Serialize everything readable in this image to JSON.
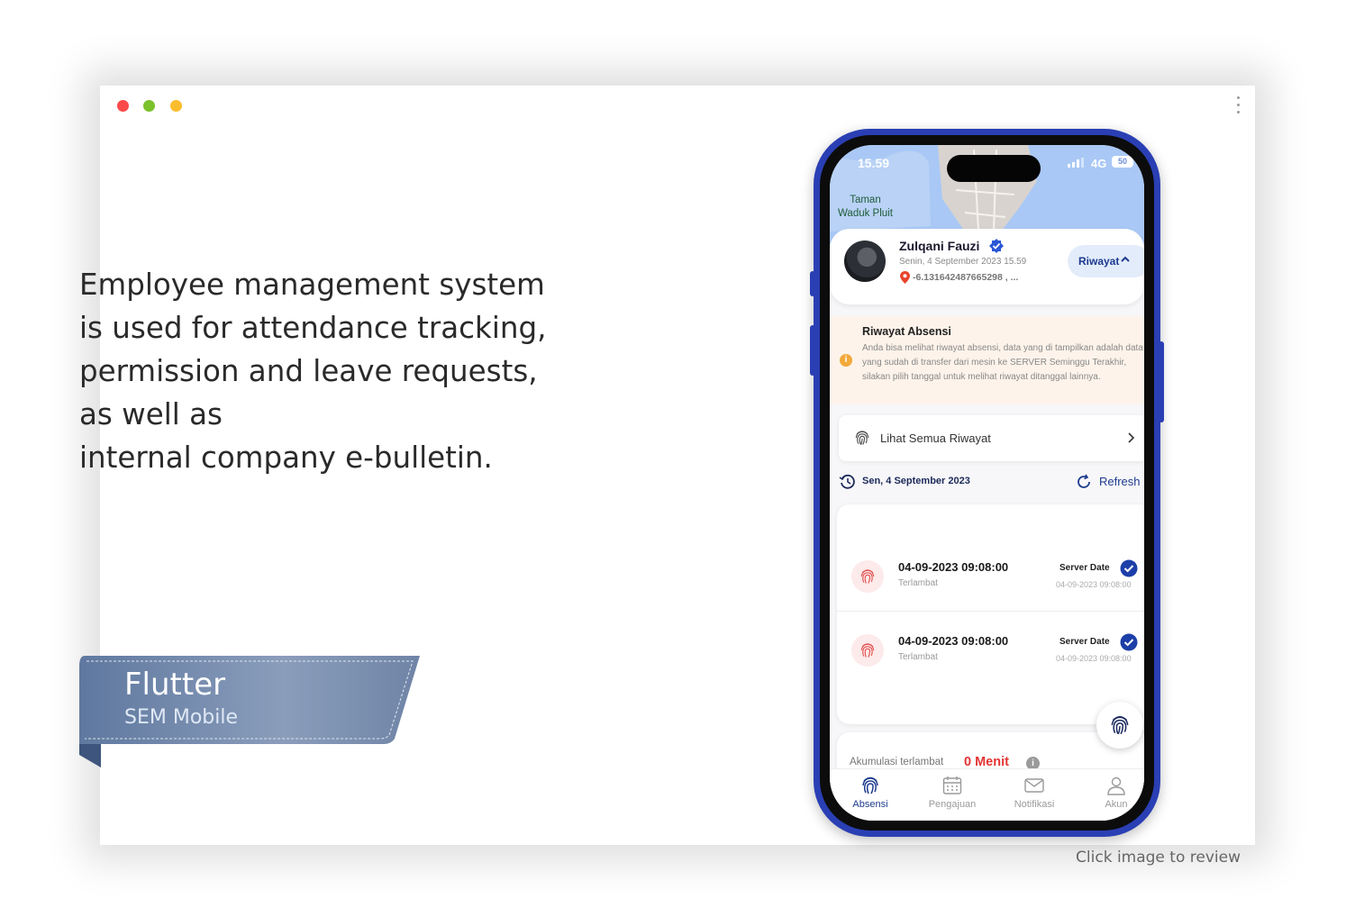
{
  "description": {
    "lines": [
      "Employee management system",
      "is used for attendance tracking,",
      "permission and leave requests,",
      "as well as",
      "internal company e-bulletin."
    ]
  },
  "ribbon": {
    "title": "Flutter",
    "subtitle": "SEM Mobile"
  },
  "hint": "Click image to review",
  "phone": {
    "status": {
      "time": "15.59",
      "network": "4G",
      "battery": "50"
    },
    "map_label": "Taman\nWaduk Pluit",
    "profile": {
      "name": "Zulqani Fauzi",
      "datetime": "Senin, 4 September 2023 15.59",
      "location": "-6.131642487665298 , ...",
      "history_button": "Riwayat"
    },
    "info": {
      "title": "Riwayat Absensi",
      "body": "Anda bisa melihat riwayat absensi, data yang di tampilkan adalah data yang sudah di transfer dari mesin ke SERVER Seminggu Terakhir, silakan pilih tanggal untuk melihat riwayat  ditanggal lainnya."
    },
    "all_history": "Lihat Semua Riwayat",
    "date_bar": {
      "date": "Sen, 4 September 2023",
      "refresh": "Refresh"
    },
    "records": [
      {
        "datetime": "04-09-2023 09:08:00",
        "status": "Terlambat",
        "server_label": "Server Date",
        "server_date": "04-09-2023 09:08:00"
      },
      {
        "datetime": "04-09-2023 09:08:00",
        "status": "Terlambat",
        "server_label": "Server Date",
        "server_date": "04-09-2023 09:08:00"
      }
    ],
    "accumulation": {
      "label": "Akumulasi terlambat",
      "value": "0 Menit",
      "info_icon": "i"
    },
    "nav": [
      {
        "label": "Absensi",
        "icon": "fingerprint-icon",
        "active": true
      },
      {
        "label": "Pengajuan",
        "icon": "calendar-icon",
        "active": false
      },
      {
        "label": "Notifikasi",
        "icon": "mail-icon",
        "active": false
      },
      {
        "label": "Akun",
        "icon": "user-icon",
        "active": false
      }
    ]
  },
  "colors": {
    "phone_frame": "#2a3fb4",
    "accent": "#1c3a8e",
    "late_red": "#e33434",
    "info_bg": "#fdf3ea",
    "ribbon": "#7e93b5"
  }
}
